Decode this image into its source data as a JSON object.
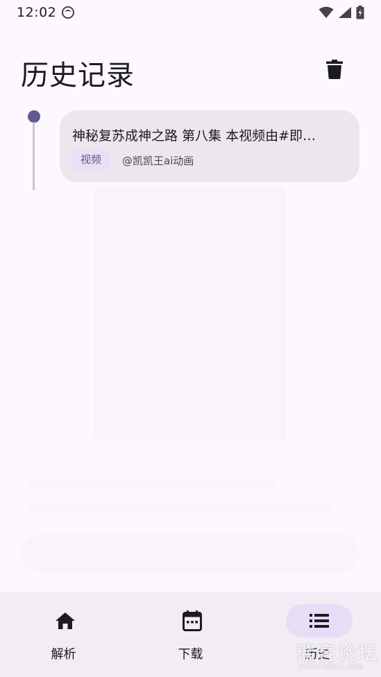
{
  "status_bar": {
    "time": "12:02"
  },
  "header": {
    "title": "历史记录",
    "delete_icon": "trash-icon"
  },
  "history": {
    "items": [
      {
        "title": "神秘复苏成神之路 第八集 本视频由#即…",
        "tag": "视频",
        "author": "@凯凯王ai动画"
      }
    ]
  },
  "bottom_nav": {
    "items": [
      {
        "label": "解析",
        "icon": "home-icon",
        "active": false
      },
      {
        "label": "下载",
        "icon": "calendar-icon",
        "active": false
      },
      {
        "label": "历史",
        "icon": "list-icon",
        "active": true
      }
    ]
  },
  "watermark": {
    "title": "瑞客论坛",
    "url": "www.ruike1.com"
  },
  "colors": {
    "background": "#fdf7fe",
    "accent": "#625b8f",
    "card": "#ece6ee",
    "tag_bg": "#e7e0f7",
    "nav_bg": "#f2ecf4",
    "nav_active": "#e6def7"
  }
}
